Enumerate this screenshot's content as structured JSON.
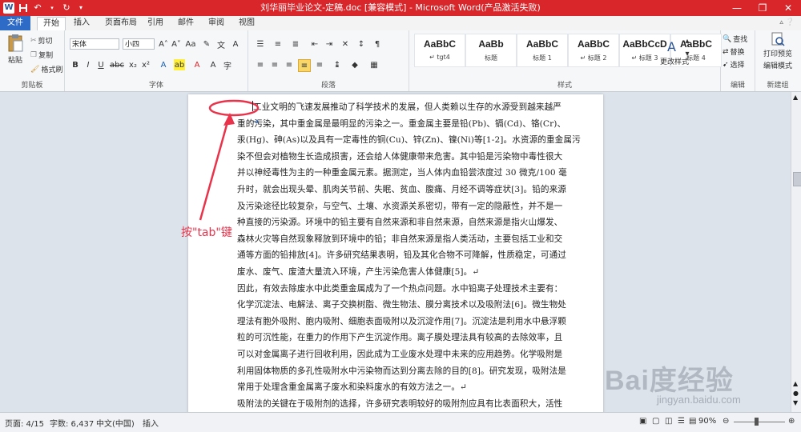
{
  "title_bar": {
    "title": "刘华丽毕业论文-定稿.doc [兼容模式] - Microsoft Word(产品激活失败)",
    "accent_color": "#d9262b"
  },
  "quick_access": {
    "logo": "W",
    "icons": [
      "save-icon",
      "undo-icon",
      "redo-icon",
      "customize-icon"
    ]
  },
  "tabs": [
    {
      "label": "文件"
    },
    {
      "label": "开始"
    },
    {
      "label": "插入"
    },
    {
      "label": "页面布局"
    },
    {
      "label": "引用"
    },
    {
      "label": "邮件"
    },
    {
      "label": "审阅"
    },
    {
      "label": "视图"
    }
  ],
  "ribbon": {
    "clipboard": {
      "group_label": "剪贴板",
      "paste": "粘贴",
      "cut": "剪切",
      "copy": "复制",
      "format_painter": "格式刷"
    },
    "font": {
      "group_label": "字体",
      "font_name": "宋体",
      "font_size": "小四"
    },
    "paragraph": {
      "group_label": "段落"
    },
    "styles": {
      "group_label": "样式",
      "items": [
        {
          "preview": "AaBbC",
          "name": "↵ tgt4"
        },
        {
          "preview": "AaBb",
          "name": "标题"
        },
        {
          "preview": "AaBbC",
          "name": "标题 1"
        },
        {
          "preview": "AaBbC",
          "name": "↵ 标题 2"
        },
        {
          "preview": "AaBbCcD",
          "name": "↵ 标题 3"
        },
        {
          "preview": "AaBbC",
          "name": "标题 4"
        }
      ],
      "change_styles": "更改样式"
    },
    "editing": {
      "group_label": "编辑",
      "find": "查找",
      "replace": "替换",
      "select": "选择"
    },
    "new_group": {
      "group_label": "新建组",
      "print_preview": "打印预览",
      "edit_mode": "编辑模式"
    }
  },
  "document": {
    "lines": [
      "工业文明的飞速发展推动了科学技术的发展，但人类赖以生存的水源受到越来越严",
      "重的污染，其中重金属是最明显的污染之一。重金属主要是铅(Pb)、镉(Cd)、铬(Cr)、",
      "汞(Hg)、砷(As)以及具有一定毒性的铜(Cu)、锌(Zn)、镍(Ni)等[1-2]。水资源的重金属污",
      "染不但会对植物生长造成损害，还会给人体健康带来危害。其中铅是污染物中毒性很大",
      "并以神经毒性为主的一种重金属元素。据测定，当人体内血铅尝浓度过 30 微克/100 毫",
      "升时，就会出现头晕、肌肉关节前、失眠、贫血、腹痛、月经不调等症状[3]。铅的来源",
      "及污染途径比较复杂，与空气、土壤、水资源关系密切，带有一定的隐蔽性，并不是一",
      "种直接的污染源。环境中的铅主要有自然来源和非自然来源，自然来源是指火山爆发、",
      "森林火灾等自然现象释放到环境中的铅；非自然来源是指人类活动，主要包括工业和交",
      "通等方面的铅排放[4]。许多研究结果表明，铅及其化合物不可降解，性质稳定，可通过",
      "废水、废气、废渣大量流入环境，产生污染危害人体健康[5]。↵",
      "因此，有效去除废水中此类重金属成为了一个热点问题。水中铅离子处理技术主要有：",
      "化学沉淀法、电解法、离子交换树脂、微生物法、膜分离技术以及吸附法[6]。微生物处",
      "理法有胞外吸附、胞内吸附、细胞表面吸附以及沉淀作用[7]。沉淀法是利用水中悬浮颗",
      "粒的可沉性能，在重力的作用下产生沉淀作用。离子膜处理法具有较高的去除效率，且",
      "可以对金属离子进行回收利用，因此成为工业废水处理中未来的应用趋势。化学吸附是",
      "利用固体物质的多孔性吸附水中污染物而达到分离去除的目的[8]。研究发现，吸附法是",
      "常用于处理含重金属离子废水和染料废水的有效方法之一。↵",
      "吸附法的关键在于吸附剂的选择，许多研究表明较好的吸附剂应具有比表面积大，活性"
    ]
  },
  "annotation": {
    "label": "按\"tab\"键",
    "color": "#e8334a"
  },
  "watermark": {
    "text": "Bai度经验",
    "sub": "jingyan.baidu.com"
  },
  "status_bar": {
    "page": "页面: 4/15",
    "words": "字数: 6,437",
    "language": "中文(中国)",
    "insert_mode": "插入",
    "zoom": "90%"
  }
}
